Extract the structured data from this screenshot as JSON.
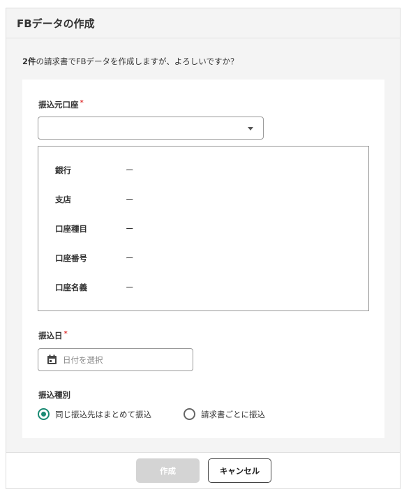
{
  "dialog": {
    "title": "FBデータの作成",
    "confirm_count": "2件",
    "confirm_text": "の請求書でFBデータを作成しますが、よろしいですか？"
  },
  "form": {
    "source_account": {
      "label": "振込元口座",
      "required_mark": "*",
      "value": ""
    },
    "account_info": [
      {
        "key": "銀行",
        "value": "ー"
      },
      {
        "key": "支店",
        "value": "ー"
      },
      {
        "key": "口座種目",
        "value": "ー"
      },
      {
        "key": "口座番号",
        "value": "ー"
      },
      {
        "key": "口座名義",
        "value": "ー"
      }
    ],
    "transfer_date": {
      "label": "振込日",
      "required_mark": "*",
      "placeholder": "日付を選択"
    },
    "transfer_type": {
      "label": "振込種別",
      "options": [
        {
          "label": "同じ振込先はまとめて振込",
          "checked": true
        },
        {
          "label": "請求書ごとに振込",
          "checked": false
        }
      ]
    }
  },
  "footer": {
    "create_label": "作成",
    "cancel_label": "キャンセル"
  },
  "colors": {
    "accent": "#1a8a73",
    "required": "#e03a3a",
    "disabled_button": "#d4d4d4"
  }
}
